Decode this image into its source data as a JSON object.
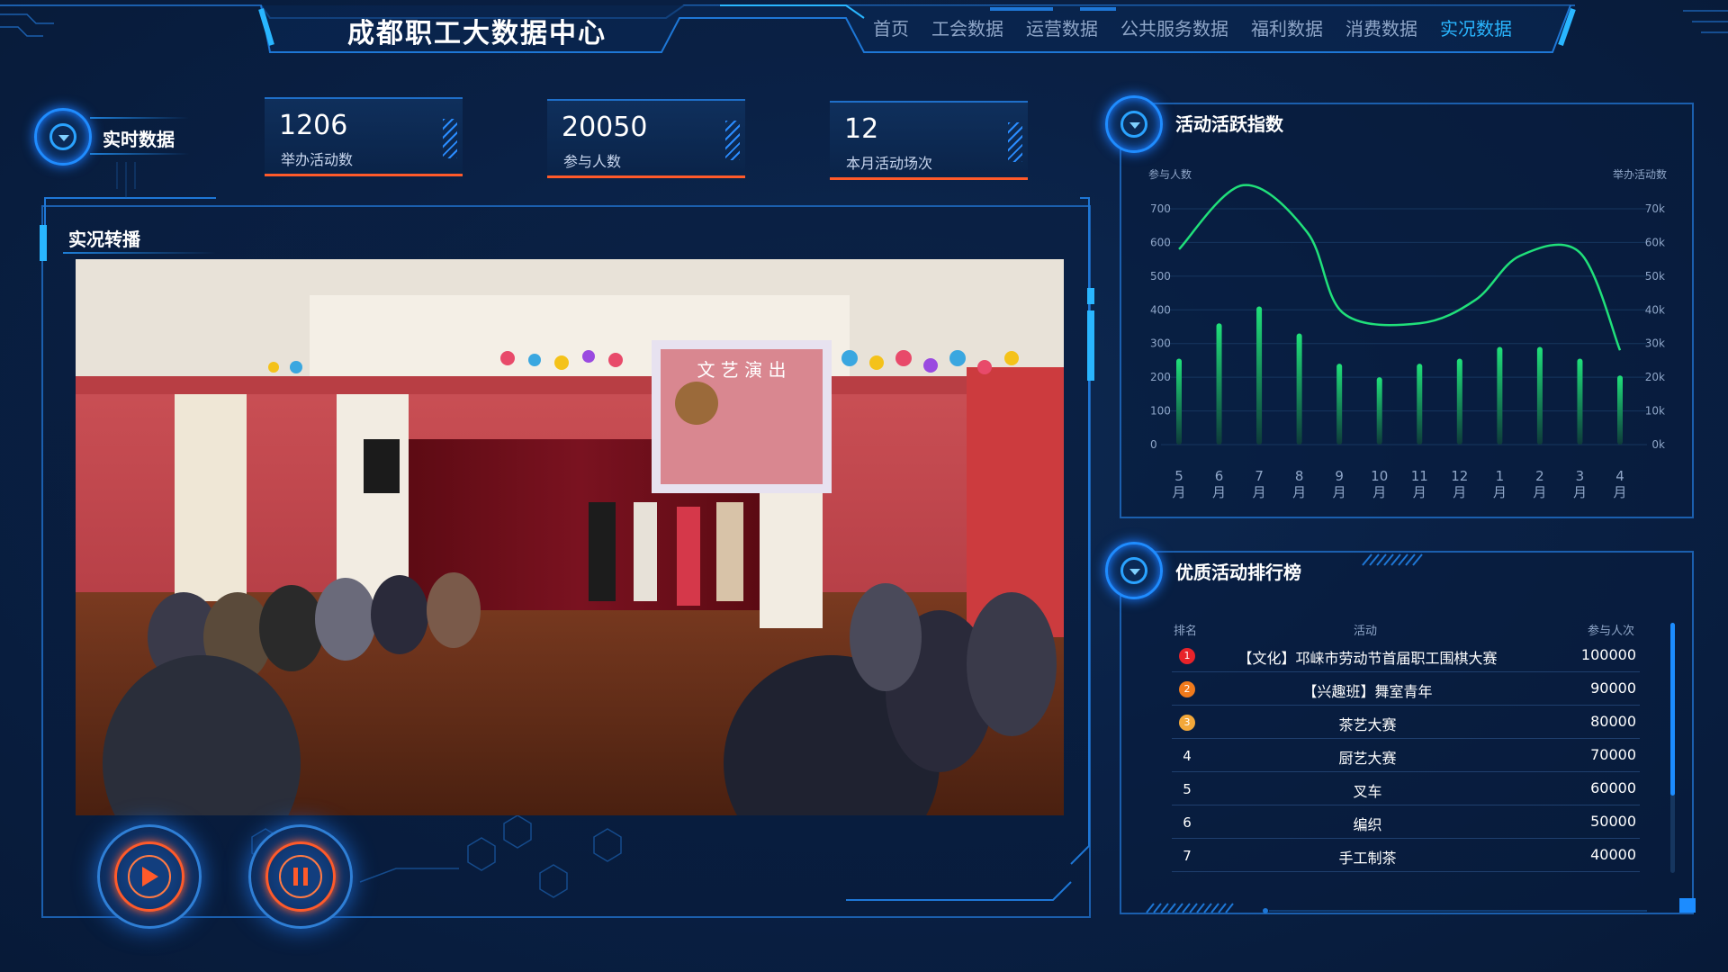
{
  "header": {
    "title": "成都职工大数据中心",
    "nav": [
      {
        "label": "首页",
        "active": false
      },
      {
        "label": "工会数据",
        "active": false
      },
      {
        "label": "运营数据",
        "active": false
      },
      {
        "label": "公共服务数据",
        "active": false
      },
      {
        "label": "福利数据",
        "active": false
      },
      {
        "label": "消费数据",
        "active": false
      },
      {
        "label": "实况数据",
        "active": true
      }
    ]
  },
  "realtime": {
    "section_title": "实时数据",
    "stats": [
      {
        "value": "1206",
        "label": "举办活动数"
      },
      {
        "value": "20050",
        "label": "参与人数"
      },
      {
        "value": "12",
        "label": "本月活动场次"
      }
    ]
  },
  "live": {
    "section_title": "实况转播",
    "stage_banner": "文 艺 演 出",
    "play_icon": "play-icon",
    "pause_icon": "pause-icon"
  },
  "activity_chart": {
    "section_title": "活动活跃指数"
  },
  "chart_data": {
    "type": "bar",
    "categories": [
      "5\n月",
      "6\n月",
      "7\n月",
      "8\n月",
      "9\n月",
      "10\n月",
      "11\n月",
      "12\n月",
      "1\n月",
      "2\n月",
      "3\n月",
      "4\n月"
    ],
    "category_numbers": [
      "5",
      "6",
      "7",
      "8",
      "9",
      "10",
      "11",
      "12",
      "1",
      "2",
      "3",
      "4"
    ],
    "category_unit": "月",
    "ylabel": "参与人数",
    "y2label": "举办活动数",
    "ylim": [
      0,
      700
    ],
    "y_ticks": [
      "0",
      "100",
      "200",
      "300",
      "400",
      "500",
      "600",
      "700"
    ],
    "y2lim": [
      0,
      70000
    ],
    "y2_ticks": [
      "0k",
      "10k",
      "20k",
      "30k",
      "40k",
      "50k",
      "60k",
      "70k"
    ],
    "series": [
      {
        "type": "bar",
        "axis": "left",
        "values": [
          255,
          360,
          410,
          330,
          240,
          200,
          240,
          255,
          290,
          290,
          255,
          205
        ]
      },
      {
        "type": "line",
        "axis": "right",
        "values": [
          58000,
          77000,
          63000,
          39000,
          36000,
          43000,
          56000,
          57000,
          28000
        ]
      }
    ],
    "line_x_positions_in_months": [
      0,
      1.6,
      3.2,
      4.1,
      6.0,
      7.4,
      8.5,
      10.0,
      11.0
    ],
    "grid": true,
    "colors": {
      "bar": "#20e07a",
      "line": "#20e07a"
    }
  },
  "ranking": {
    "section_title": "优质活动排行榜",
    "columns": [
      "排名",
      "活动",
      "参与人次"
    ],
    "rows": [
      {
        "rank": "1",
        "name": "【文化】邛崃市劳动节首届职工围棋大赛",
        "count": "100000",
        "badge_color": "#e8232a"
      },
      {
        "rank": "2",
        "name": "【兴趣班】舞室青年",
        "count": "90000",
        "badge_color": "#f07a1c"
      },
      {
        "rank": "3",
        "name": "茶艺大赛",
        "count": "80000",
        "badge_color": "#f3a83a"
      },
      {
        "rank": "4",
        "name": "厨艺大赛",
        "count": "70000",
        "badge_color": ""
      },
      {
        "rank": "5",
        "name": "叉车",
        "count": "60000",
        "badge_color": ""
      },
      {
        "rank": "6",
        "name": "编织",
        "count": "50000",
        "badge_color": ""
      },
      {
        "rank": "7",
        "name": "手工制茶",
        "count": "40000",
        "badge_color": ""
      }
    ]
  },
  "colors": {
    "accent": "#29b6ff",
    "frame": "#1b5fae",
    "orange": "#ff5a2a",
    "green": "#20e07a"
  }
}
